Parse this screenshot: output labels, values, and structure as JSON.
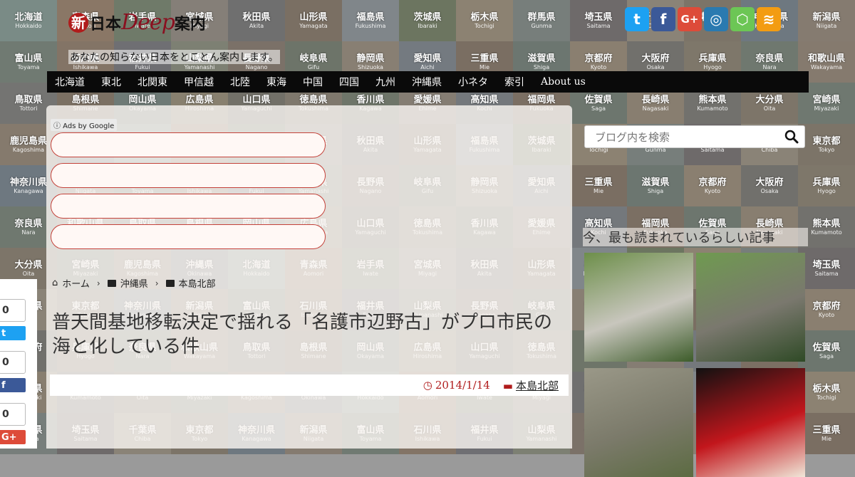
{
  "bg_tiles": [
    {
      "name": "北海道",
      "roman": "Hokkaido",
      "color": "#7a8b86"
    },
    {
      "name": "青森県",
      "roman": "Aomori",
      "color": "#8a7766"
    },
    {
      "name": "岩手県",
      "roman": "Iwate",
      "color": "#6f7a69"
    },
    {
      "name": "宮城県",
      "roman": "Miyagi",
      "color": "#857f78"
    },
    {
      "name": "秋田県",
      "roman": "Akita",
      "color": "#6f6f6f"
    },
    {
      "name": "山形県",
      "roman": "Yamagata",
      "color": "#7a6f63"
    },
    {
      "name": "福島県",
      "roman": "Fukushima",
      "color": "#80868a"
    },
    {
      "name": "茨城県",
      "roman": "Ibaraki",
      "color": "#6c7560"
    },
    {
      "name": "栃木県",
      "roman": "Tochigi",
      "color": "#8c8272"
    },
    {
      "name": "群馬県",
      "roman": "Gunma",
      "color": "#777e7b"
    },
    {
      "name": "埼玉県",
      "roman": "Saitama",
      "color": "#6e6a6a"
    },
    {
      "name": "千葉県",
      "roman": "Chiba",
      "color": "#8a8377"
    },
    {
      "name": "東京都",
      "roman": "Tokyo",
      "color": "#7c7468"
    },
    {
      "name": "神奈川県",
      "roman": "Kanagawa",
      "color": "#6e7880"
    },
    {
      "name": "新潟県",
      "roman": "Niigata",
      "color": "#857b70"
    },
    {
      "name": "富山県",
      "roman": "Toyama",
      "color": "#707a72"
    },
    {
      "name": "石川県",
      "roman": "Ishikawa",
      "color": "#837466"
    },
    {
      "name": "福井県",
      "roman": "Fukui",
      "color": "#6f6f73"
    },
    {
      "name": "山梨県",
      "roman": "Yamanashi",
      "color": "#7d8073"
    },
    {
      "name": "長野県",
      "roman": "Nagano",
      "color": "#7b7168"
    },
    {
      "name": "岐阜県",
      "roman": "Gifu",
      "color": "#6d7469"
    },
    {
      "name": "静岡県",
      "roman": "Shizuoka",
      "color": "#887f73"
    },
    {
      "name": "愛知県",
      "roman": "Aichi",
      "color": "#747a80"
    },
    {
      "name": "三重県",
      "roman": "Mie",
      "color": "#7a6e62"
    },
    {
      "name": "滋賀県",
      "roman": "Shiga",
      "color": "#6c7670"
    },
    {
      "name": "京都府",
      "roman": "Kyoto",
      "color": "#8a7f70"
    },
    {
      "name": "大阪府",
      "roman": "Osaka",
      "color": "#71706c"
    },
    {
      "name": "兵庫県",
      "roman": "Hyogo",
      "color": "#7e776a"
    },
    {
      "name": "奈良県",
      "roman": "Nara",
      "color": "#6f786f"
    },
    {
      "name": "和歌山県",
      "roman": "Wakayama",
      "color": "#857a6e"
    },
    {
      "name": "鳥取県",
      "roman": "Tottori",
      "color": "#747472"
    },
    {
      "name": "島根県",
      "roman": "Shimane",
      "color": "#7b7063"
    },
    {
      "name": "岡山県",
      "roman": "Okayama",
      "color": "#6e7a76"
    },
    {
      "name": "広島県",
      "roman": "Hiroshima",
      "color": "#88806f"
    },
    {
      "name": "山口県",
      "roman": "Yamaguchi",
      "color": "#727068"
    },
    {
      "name": "徳島県",
      "roman": "Tokushima",
      "color": "#7f786d"
    },
    {
      "name": "香川県",
      "roman": "Kagawa",
      "color": "#6e7569"
    },
    {
      "name": "愛媛県",
      "roman": "Ehime",
      "color": "#857d73"
    },
    {
      "name": "高知県",
      "roman": "Kochi",
      "color": "#74787c"
    },
    {
      "name": "福岡県",
      "roman": "Fukuoka",
      "color": "#7b6f63"
    },
    {
      "name": "佐賀県",
      "roman": "Saga",
      "color": "#6d766e"
    },
    {
      "name": "長崎県",
      "roman": "Nagasaki",
      "color": "#887e70"
    },
    {
      "name": "熊本県",
      "roman": "Kumamoto",
      "color": "#72716d"
    },
    {
      "name": "大分県",
      "roman": "Oita",
      "color": "#7d7569"
    },
    {
      "name": "宮崎県",
      "roman": "Miyazaki",
      "color": "#6f7870"
    },
    {
      "name": "鹿児島県",
      "roman": "Kagoshima",
      "color": "#857a6d"
    },
    {
      "name": "沖縄県",
      "roman": "Okinawa",
      "color": "#707378"
    }
  ],
  "header": {
    "logo": {
      "badge": "新",
      "part1": "日本",
      "part2": "Deep",
      "part3": "案内"
    },
    "tagline": "あなたの知らない日本をとことん案内します。"
  },
  "social": [
    {
      "name": "twitter-icon",
      "glyph": "t",
      "color": "#1da1f2"
    },
    {
      "name": "facebook-icon",
      "glyph": "f",
      "color": "#3b5998"
    },
    {
      "name": "google-plus-icon",
      "glyph": "G+",
      "color": "#dd4b39"
    },
    {
      "name": "instagram-icon",
      "glyph": "◎",
      "color": "#2a7ab0"
    },
    {
      "name": "feedly-icon",
      "glyph": "⬡",
      "color": "#6cc655"
    },
    {
      "name": "rss-icon",
      "glyph": "≋",
      "color": "#f39c12"
    }
  ],
  "nav": [
    "北海道",
    "東北",
    "北関東",
    "甲信越",
    "北陸",
    "東海",
    "中国",
    "四国",
    "九州",
    "沖縄県",
    "小ネタ",
    "索引",
    "About us"
  ],
  "ads_label": "ⓘ Ads by Google",
  "breadcrumb": [
    "ホーム",
    "沖縄県",
    "本島北部"
  ],
  "article": {
    "title": "普天間基地移転決定で揺れる「名護市辺野古」がプロ市民の海と化している件",
    "date": "2014/1/14",
    "category": "本島北部"
  },
  "share": [
    {
      "count": "0",
      "label": "t",
      "color": "#1da1f2",
      "name": "share-twitter"
    },
    {
      "count": "0",
      "label": "f",
      "color": "#3b5998",
      "name": "share-facebook"
    },
    {
      "count": "0",
      "label": "G+",
      "color": "#dd4b39",
      "name": "share-google-plus"
    }
  ],
  "search": {
    "placeholder": "ブログ内を検索"
  },
  "sidebar": {
    "popular_title": "今、最も読まれているらしい記事"
  },
  "thumbnails": [
    {
      "name": "thumb-onsen-town",
      "colors": [
        "#6d8f4a",
        "#c8c6bd",
        "#3d5c2a"
      ]
    },
    {
      "name": "thumb-statue",
      "colors": [
        "#6f9a50",
        "#7a786e",
        "#2f4a26"
      ]
    },
    {
      "name": "thumb-gravestones",
      "colors": [
        "#9a9888",
        "#7b7a6a",
        "#5c6b42"
      ]
    },
    {
      "name": "thumb-sasashima",
      "colors": [
        "#111111",
        "#c2161c",
        "#f0e6d8"
      ]
    }
  ]
}
